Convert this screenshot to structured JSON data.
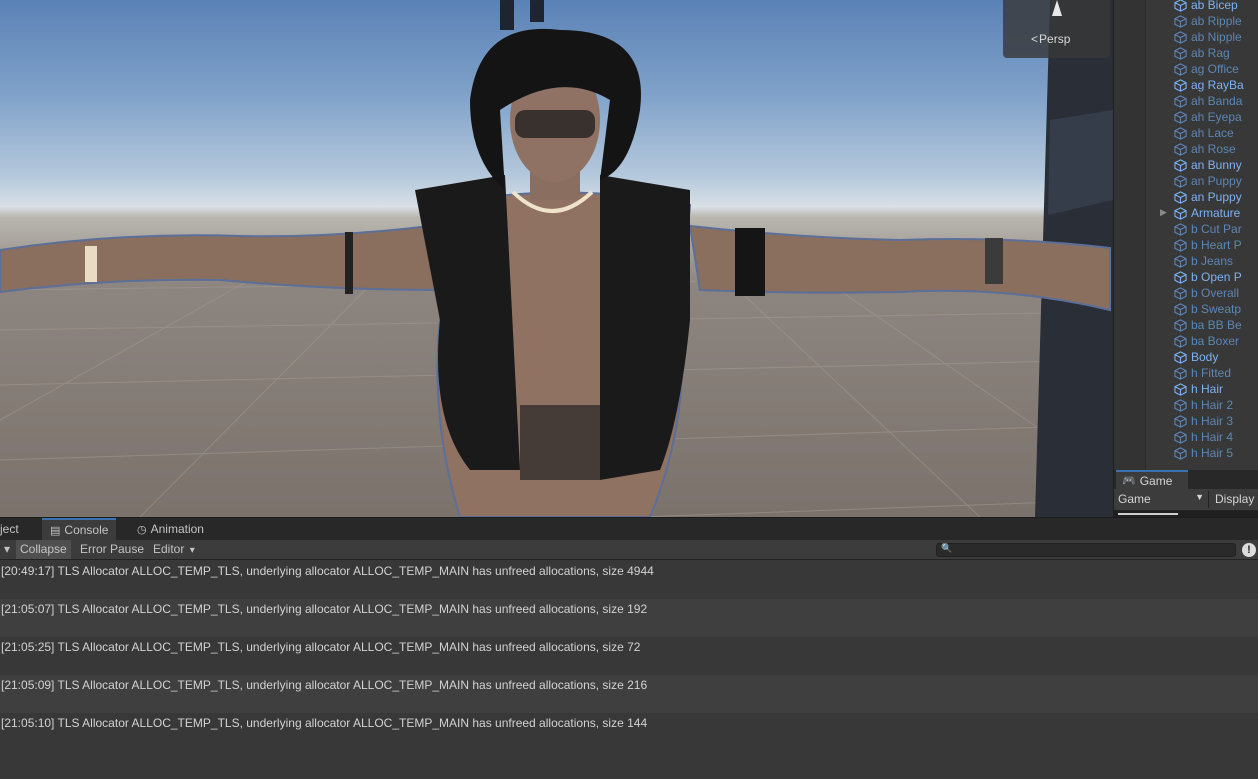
{
  "scene": {
    "view_mode": "Persp",
    "gizmo_icon": "perspective-cone-icon"
  },
  "hierarchy": {
    "items": [
      {
        "label": "ab Bicep",
        "state": "bright"
      },
      {
        "label": "ab Ripple",
        "state": "dim"
      },
      {
        "label": "ab Nipple",
        "state": "dim"
      },
      {
        "label": "ab Rag",
        "state": "dim"
      },
      {
        "label": "ag Office",
        "state": "dim"
      },
      {
        "label": "ag RayBa",
        "state": "bright"
      },
      {
        "label": "ah Banda",
        "state": "dim"
      },
      {
        "label": "ah Eyepa",
        "state": "dim"
      },
      {
        "label": "ah Lace",
        "state": "dim"
      },
      {
        "label": "ah Rose",
        "state": "dim"
      },
      {
        "label": "an Bunny",
        "state": "bright"
      },
      {
        "label": "an Puppy",
        "state": "dim"
      },
      {
        "label": "an Puppy",
        "state": "bright"
      },
      {
        "label": "Armature",
        "state": "bright",
        "foldout": true
      },
      {
        "label": "b Cut Par",
        "state": "dim"
      },
      {
        "label": "b Heart P",
        "state": "dim"
      },
      {
        "label": "b Jeans",
        "state": "dim"
      },
      {
        "label": "b Open P",
        "state": "bright"
      },
      {
        "label": "b Overall",
        "state": "dim"
      },
      {
        "label": "b Sweatp",
        "state": "dim"
      },
      {
        "label": "ba BB Be",
        "state": "dim"
      },
      {
        "label": "ba Boxer",
        "state": "dim"
      },
      {
        "label": "Body",
        "state": "bright"
      },
      {
        "label": "h Fitted",
        "state": "dim"
      },
      {
        "label": "h Hair",
        "state": "bright"
      },
      {
        "label": "h Hair 2",
        "state": "dim"
      },
      {
        "label": "h Hair 3",
        "state": "dim"
      },
      {
        "label": "h Hair 4",
        "state": "dim"
      },
      {
        "label": "h Hair 5",
        "state": "dim"
      }
    ]
  },
  "game_panel": {
    "tab_label": "Game",
    "tab_icon": "gamepad-icon",
    "select_value": "Game",
    "display_label": "Display"
  },
  "bottom": {
    "tabs": [
      {
        "label": "ject",
        "icon": ""
      },
      {
        "label": "Console",
        "icon": "console-icon",
        "active": true
      },
      {
        "label": "Animation",
        "icon": "animation-clock-icon"
      }
    ],
    "toolbar": {
      "clear_dropdown_caret": "▾",
      "collapse": "Collapse",
      "error_pause": "Error Pause",
      "editor": "Editor",
      "search_placeholder": "",
      "warn_icon": "!"
    },
    "logs": [
      {
        "text": "[20:49:17] TLS Allocator ALLOC_TEMP_TLS, underlying allocator ALLOC_TEMP_MAIN has unfreed allocations, size 4944"
      },
      {
        "text": "[21:05:07] TLS Allocator ALLOC_TEMP_TLS, underlying allocator ALLOC_TEMP_MAIN has unfreed allocations, size 192"
      },
      {
        "text": "[21:05:25] TLS Allocator ALLOC_TEMP_TLS, underlying allocator ALLOC_TEMP_MAIN has unfreed allocations, size 72"
      },
      {
        "text": "[21:05:09] TLS Allocator ALLOC_TEMP_TLS, underlying allocator ALLOC_TEMP_MAIN has unfreed allocations, size 216"
      },
      {
        "text": "[21:05:10] TLS Allocator ALLOC_TEMP_TLS, underlying allocator ALLOC_TEMP_MAIN has unfreed allocations, size 144"
      }
    ]
  },
  "colors": {
    "accent": "#3a72b0",
    "hierarchy_bright": "#7cb2f2",
    "hierarchy_dim": "#5c86b6",
    "panel_bg": "#383838"
  }
}
